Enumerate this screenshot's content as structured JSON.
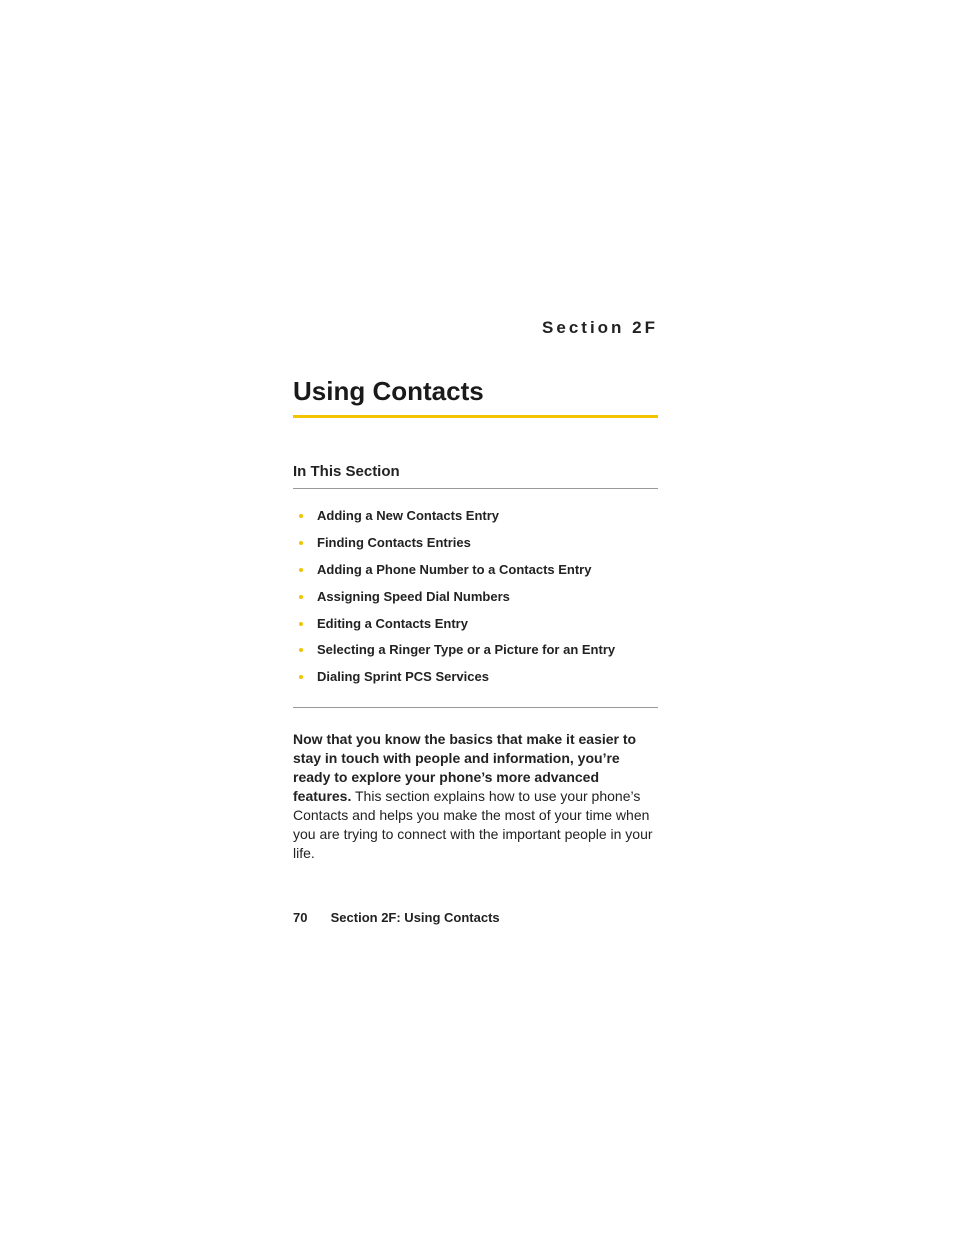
{
  "section_label": "Section 2F",
  "title": "Using Contacts",
  "sub_heading": "In This Section",
  "toc": [
    "Adding a New Contacts Entry",
    "Finding Contacts Entries",
    "Adding a Phone Number to a Contacts Entry",
    "Assigning Speed Dial Numbers",
    "Editing a Contacts Entry",
    "Selecting a Ringer Type or a Picture for an Entry",
    "Dialing Sprint PCS Services"
  ],
  "body_lead": "Now that you know the basics that make it easier to stay in touch with people and information, you’re ready to explore your phone’s more advanced features.",
  "body_rest": " This section explains how to use your phone’s Contacts and helps you make the most of your time when you are trying to connect with the important people in your life.",
  "footer": {
    "page_number": "70",
    "text": "Section 2F: Using Contacts"
  }
}
